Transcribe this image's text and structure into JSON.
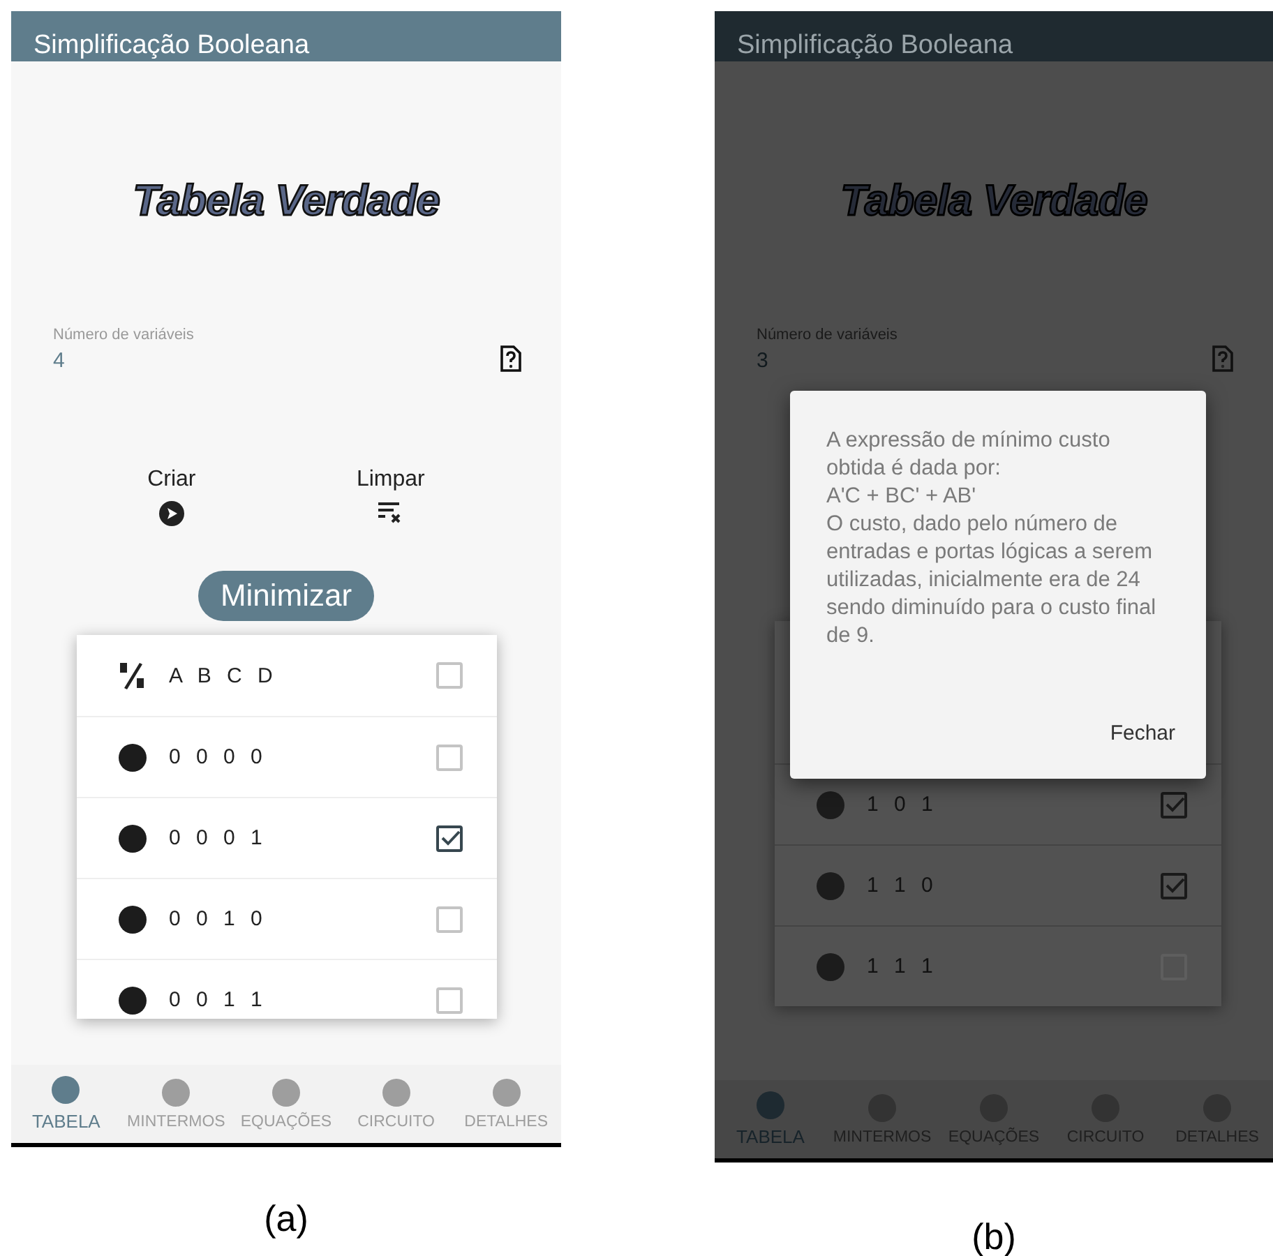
{
  "panels": [
    {
      "caption": "(a)",
      "app_bar": {
        "title": "Simplificação Booleana"
      },
      "heading": "Tabela Verdade",
      "variables_field": {
        "label": "Número de variáveis",
        "value": "4"
      },
      "actions": [
        {
          "label": "Criar",
          "kind": "play"
        },
        {
          "label": "Limpar",
          "kind": "clear"
        }
      ],
      "minimize_button": "Minimizar",
      "truth_table": {
        "header": {
          "columns": "A B C D",
          "checked": false
        },
        "rows": [
          {
            "bits": "0 0 0 0",
            "checked": false
          },
          {
            "bits": "0 0 0 1",
            "checked": true
          },
          {
            "bits": "0 0 1 0",
            "checked": false
          },
          {
            "bits": "0 0 1 1",
            "checked": false
          }
        ]
      },
      "bottom_nav": [
        {
          "label": "TABELA",
          "selected": true
        },
        {
          "label": "MINTERMOS",
          "selected": false
        },
        {
          "label": "EQUAÇÕES",
          "selected": false
        },
        {
          "label": "CIRCUITO",
          "selected": false
        },
        {
          "label": "DETALHES",
          "selected": false
        }
      ]
    },
    {
      "caption": "(b)",
      "app_bar": {
        "title": "Simplificação Booleana"
      },
      "heading": "Tabela Verdade",
      "variables_field": {
        "label": "Número de variáveis",
        "value": "3"
      },
      "truth_table": {
        "rows": [
          {
            "bits": "1 0 1",
            "checked": true
          },
          {
            "bits": "1 1 0",
            "checked": true
          },
          {
            "bits": "1 1 1",
            "checked": false
          }
        ]
      },
      "bottom_nav": [
        {
          "label": "TABELA",
          "selected": true
        },
        {
          "label": "MINTERMOS",
          "selected": false
        },
        {
          "label": "EQUAÇÕES",
          "selected": false
        },
        {
          "label": "CIRCUITO",
          "selected": false
        },
        {
          "label": "DETALHES",
          "selected": false
        }
      ],
      "dialog": {
        "message_lines": [
          "A expressão de mínimo custo",
          "obtida é dada por:",
          "A'C + BC' + AB'",
          "O custo, dado pelo número de",
          "entradas e portas lógicas a serem",
          "utilizadas, inicialmente era de 24",
          "sendo diminuído para o custo final",
          "de 9."
        ],
        "button": "Fechar"
      }
    }
  ]
}
